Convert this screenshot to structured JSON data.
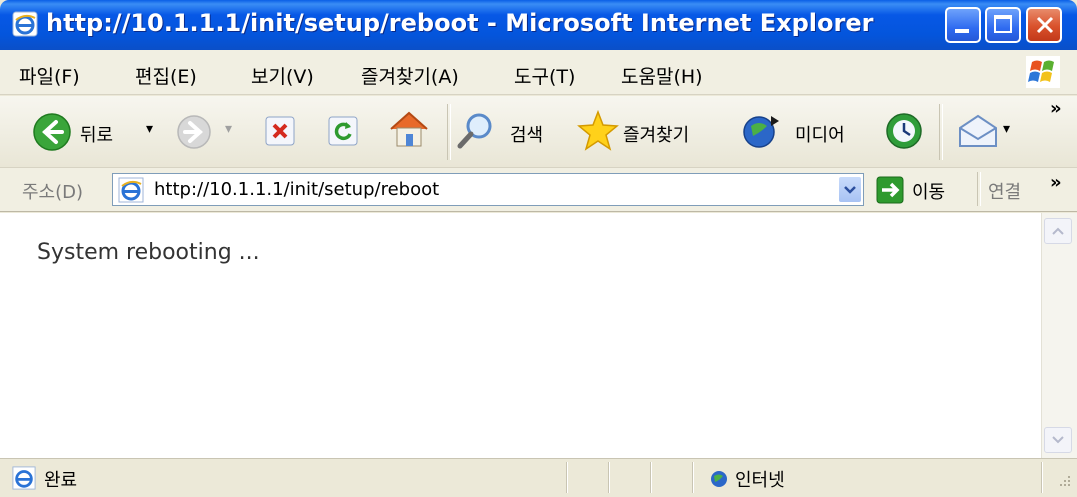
{
  "window": {
    "title": "http://10.1.1.1/init/setup/reboot - Microsoft Internet Explorer"
  },
  "menu": {
    "items": [
      "파일(F)",
      "편집(E)",
      "보기(V)",
      "즐겨찾기(A)",
      "도구(T)",
      "도움말(H)"
    ]
  },
  "toolbar": {
    "back_label": "뒤로",
    "search_label": "검색",
    "favorites_label": "즐겨찾기",
    "media_label": "미디어",
    "overflow": "»"
  },
  "address": {
    "label": "주소(D)",
    "url": "http://10.1.1.1/init/setup/reboot",
    "go_label": "이동",
    "links_label": "연결",
    "overflow": "»"
  },
  "content": {
    "message": "System rebooting ..."
  },
  "status": {
    "text": "완료",
    "zone": "인터넷"
  },
  "colors": {
    "titlebar": "#0455dc",
    "chrome": "#ece9d8",
    "go_green": "#2e9a2e"
  }
}
